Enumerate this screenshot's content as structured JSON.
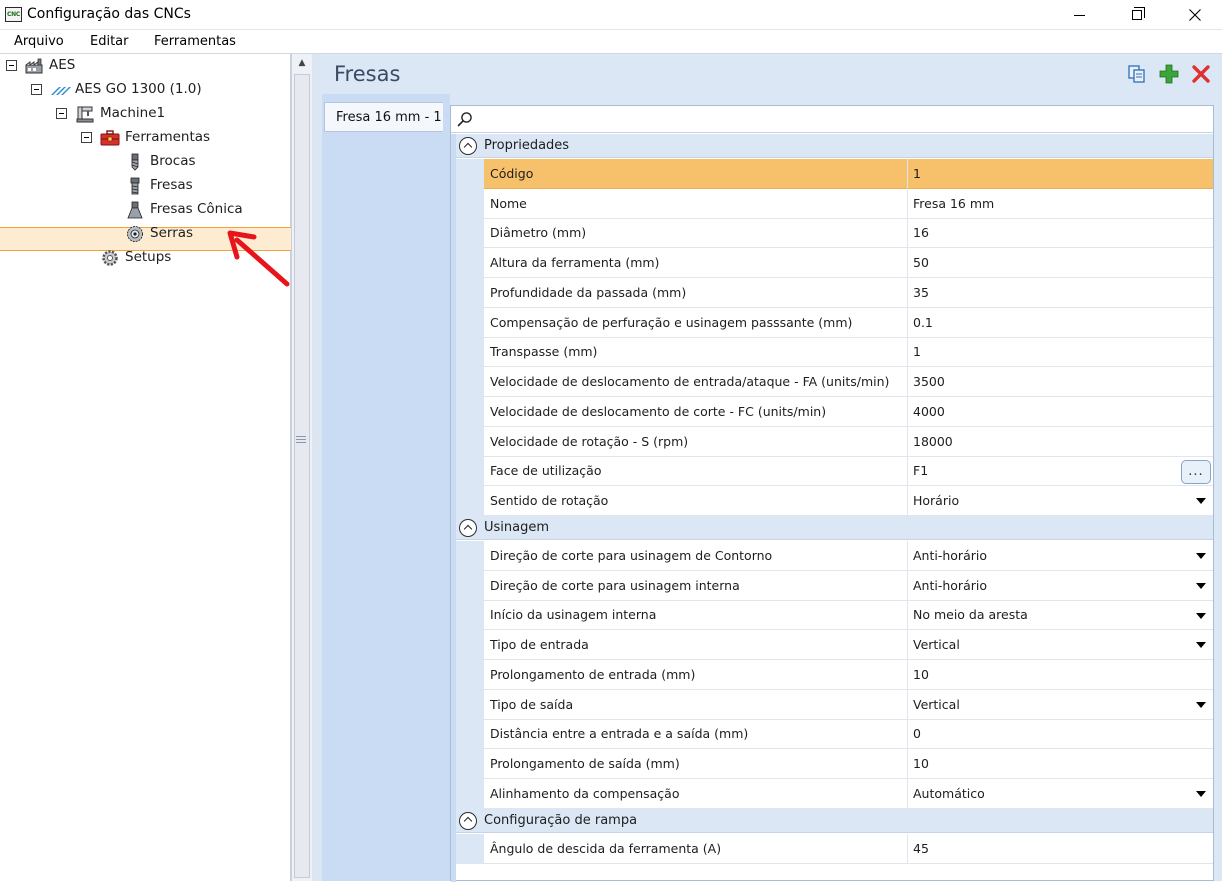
{
  "window": {
    "title": "Configuração das CNCs",
    "app_icon_text": "CNC",
    "minimize_label": "",
    "maximize_label": "",
    "close_label": ""
  },
  "menu": [
    "Arquivo",
    "Editar",
    "Ferramentas"
  ],
  "tree": [
    {
      "label": "AES",
      "icon": "factory-icon",
      "level": 0,
      "expanded": true
    },
    {
      "label": "AES GO 1300 (1.0)",
      "icon": "machine-logo-icon",
      "level": 1,
      "expanded": true
    },
    {
      "label": "Machine1",
      "icon": "machine-icon",
      "level": 2,
      "expanded": true
    },
    {
      "label": "Ferramentas",
      "icon": "toolbox-icon",
      "level": 3,
      "expanded": true
    },
    {
      "label": "Brocas",
      "icon": "drill-bit-icon",
      "level": 4
    },
    {
      "label": "Fresas",
      "icon": "milling-cutter-icon",
      "level": 4,
      "selected": true
    },
    {
      "label": "Fresas Cônica",
      "icon": "conical-cutter-icon",
      "level": 4
    },
    {
      "label": "Serras",
      "icon": "saw-blade-icon",
      "level": 4
    },
    {
      "label": "Setups",
      "icon": "gear-icon",
      "level": 3
    }
  ],
  "panel": {
    "title": "Fresas",
    "toolbar": [
      "copy-icon",
      "add-icon",
      "delete-icon"
    ],
    "tab_label": "Fresa 16 mm - 1",
    "search_placeholder": ""
  },
  "categories": [
    {
      "label": "Propriedades",
      "rows": [
        {
          "name": "Código",
          "value": "1",
          "selected": true
        },
        {
          "name": "Nome",
          "value": "Fresa 16 mm"
        },
        {
          "name": "Diâmetro (mm)",
          "value": "16"
        },
        {
          "name": "Altura da ferramenta (mm)",
          "value": "50"
        },
        {
          "name": "Profundidade da passada (mm)",
          "value": "35"
        },
        {
          "name": "Compensação de perfuração e usinagem passsante (mm)",
          "value": "0.1"
        },
        {
          "name": "Transpasse (mm)",
          "value": "1"
        },
        {
          "name": "Velocidade de deslocamento de entrada/ataque - FA (units/min)",
          "value": "3500"
        },
        {
          "name": "Velocidade de deslocamento de corte - FC (units/min)",
          "value": "4000"
        },
        {
          "name": "Velocidade de rotação - S (rpm)",
          "value": "18000"
        },
        {
          "name": "Face de utilização",
          "value": "F1",
          "editor": "ellipsis"
        },
        {
          "name": "Sentido de rotação",
          "value": "Horário",
          "editor": "dropdown"
        }
      ]
    },
    {
      "label": "Usinagem",
      "rows": [
        {
          "name": "Direção de corte para usinagem de Contorno",
          "value": "Anti-horário",
          "editor": "dropdown"
        },
        {
          "name": "Direção de corte para usinagem interna",
          "value": "Anti-horário",
          "editor": "dropdown"
        },
        {
          "name": "Início da usinagem interna",
          "value": "No meio da aresta",
          "editor": "dropdown"
        },
        {
          "name": "Tipo de entrada",
          "value": "Vertical",
          "editor": "dropdown"
        },
        {
          "name": "Prolongamento de entrada (mm)",
          "value": "10"
        },
        {
          "name": "Tipo de saída",
          "value": "Vertical",
          "editor": "dropdown"
        },
        {
          "name": "Distância entre a entrada e a saída (mm)",
          "value": "0"
        },
        {
          "name": "Prolongamento de saída (mm)",
          "value": "10"
        },
        {
          "name": "Alinhamento da compensação",
          "value": "Automático",
          "editor": "dropdown"
        }
      ]
    },
    {
      "label": "Configuração de rampa",
      "rows": [
        {
          "name": "Ângulo de descida da ferramenta (A)",
          "value": "45"
        }
      ]
    }
  ],
  "ellipsis_label": "...",
  "colors": {
    "selection": "#f7c06a",
    "tree_selection": "#fdecd2",
    "panel_bg": "#dce7f5",
    "accent_green": "#3aa53a",
    "accent_red": "#e03030",
    "annotation_arrow": "#e8141b"
  }
}
